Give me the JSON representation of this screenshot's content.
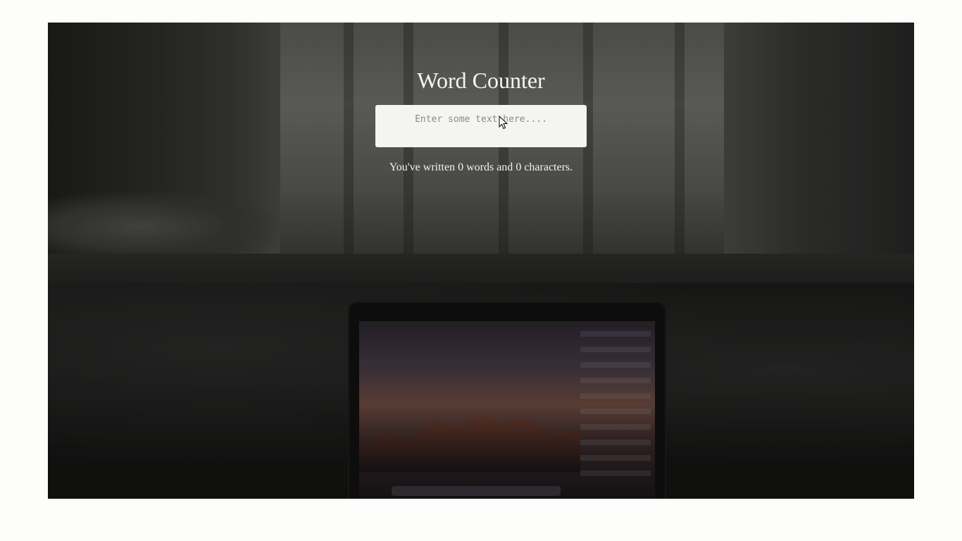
{
  "app": {
    "title": "Word Counter"
  },
  "input": {
    "placeholder": "Enter some text here....",
    "value": ""
  },
  "stats": {
    "prefix": "You've written ",
    "word_count": "0",
    "words_label": " words and ",
    "char_count": "0",
    "chars_label": " characters."
  },
  "icons": {
    "cursor": "mouse-pointer-icon"
  }
}
